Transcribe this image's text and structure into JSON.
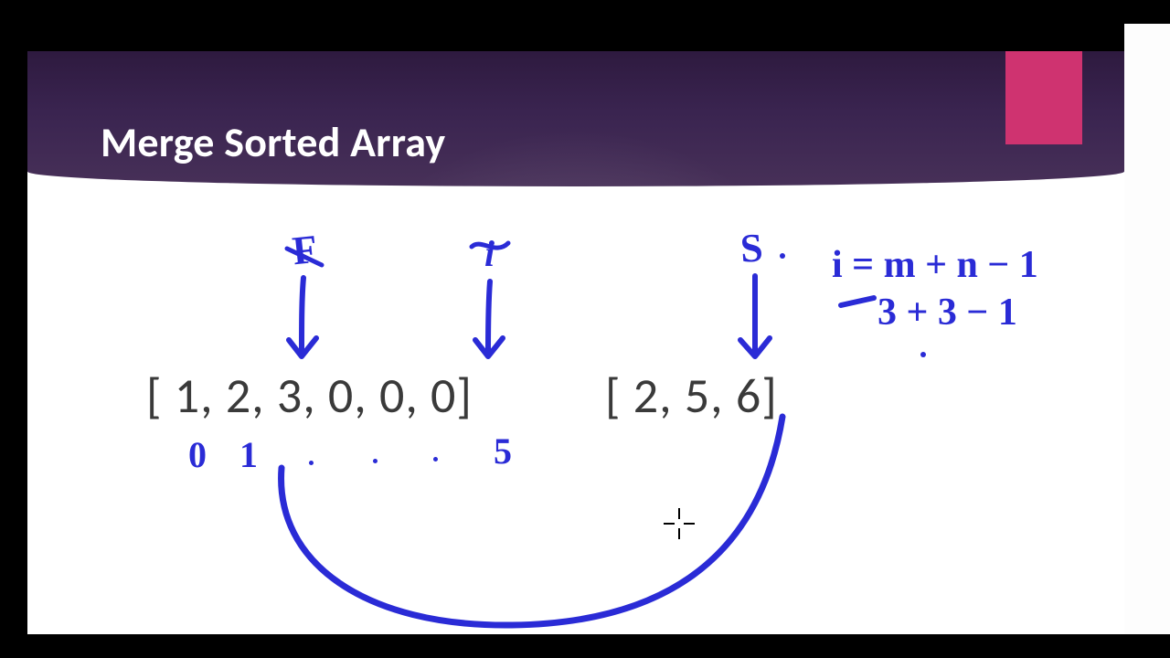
{
  "slide": {
    "title": "Merge Sorted Array",
    "arrays": {
      "nums1": "[ 1, 2, 3, 0, 0, 0]",
      "nums2": "[ 2, 5, 6]"
    }
  },
  "handwriting": {
    "label_f": "F",
    "label_i": "i",
    "label_s": "S",
    "formula_line1": "i = m + n − 1",
    "formula_line2": "3 + 3 − 1",
    "index_0": "0",
    "index_1": "1",
    "index_5": "5"
  },
  "colors": {
    "ink": "#2a2bd6",
    "accent": "#cf3370",
    "banner_dark": "#2e1a3f"
  }
}
